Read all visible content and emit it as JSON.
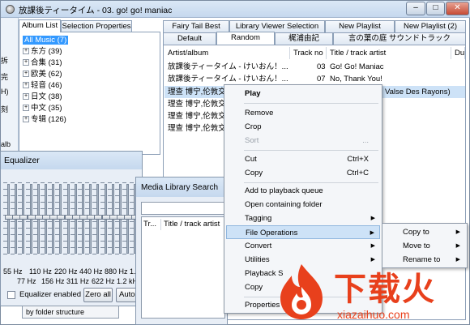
{
  "window": {
    "title": "放課後ティータイム - 03. go! go! maniac",
    "minimize": "–",
    "maximize": "□",
    "close": "✕"
  },
  "left_strip": [
    "拆",
    "完",
    "H)",
    "刻",
    "alb"
  ],
  "album_list": {
    "tabs": [
      "Album List",
      "Selection Properties"
    ],
    "items": [
      {
        "label": "All Music (7)",
        "expander": ""
      },
      {
        "label": "东方 (39)",
        "expander": "+"
      },
      {
        "label": "合集 (31)",
        "expander": "+"
      },
      {
        "label": "欧美 (62)",
        "expander": "+"
      },
      {
        "label": "轻音 (46)",
        "expander": "+"
      },
      {
        "label": "日文 (38)",
        "expander": "+"
      },
      {
        "label": "中文 (35)",
        "expander": "+"
      },
      {
        "label": "专辑 (126)",
        "expander": "+"
      }
    ]
  },
  "playlist_tabs": {
    "row1": [
      "Fairy Tail Best",
      "Library Viewer Selection",
      "New Playlist",
      "New Playlist (2)"
    ],
    "row2": [
      "Default",
      "Random",
      "梶浦由記",
      "言の葉の庭 サウンドトラック"
    ]
  },
  "playlist": {
    "columns": [
      "Artist/album",
      "Track no",
      "Title / track artist",
      "Du"
    ],
    "rows": [
      {
        "artist": "放課後ティータイム - けいおん！...",
        "track": "03",
        "title": "Go! Go! Maniac"
      },
      {
        "artist": "放課後ティータイム - けいおん！...",
        "track": "07",
        "title": "No, Thank You!"
      },
      {
        "artist": "理查 博宁,伦敦交",
        "track": "",
        "title": "Valse Des Rayons)"
      },
      {
        "artist": "理查 博宁,伦敦交",
        "track": "",
        "title": ""
      },
      {
        "artist": "理查 博宁,伦敦交",
        "track": "",
        "title": ""
      },
      {
        "artist": "理查 博宁,伦敦交",
        "track": "",
        "title": ""
      }
    ]
  },
  "equalizer": {
    "title": "Equalizer",
    "bands_row1": [
      "55 Hz",
      "110 Hz",
      "220 Hz",
      "440 Hz",
      "880 Hz",
      "1.8"
    ],
    "bands_row2": [
      "77 Hz",
      "156 Hz",
      "311 Hz",
      "622 Hz",
      "1.2 kH"
    ],
    "enabled_label": "Equalizer enabled",
    "zero_all": "Zero all",
    "auto": "Auto",
    "dropdown": "by folder structure"
  },
  "media_search": {
    "title": "Media Library Search",
    "columns": [
      "Tr...",
      "Title / track artist"
    ]
  },
  "context_menu": {
    "items": [
      {
        "label": "Play",
        "shortcut": "",
        "bold": true
      },
      {
        "label": "Remove",
        "shortcut": ""
      },
      {
        "label": "Crop",
        "shortcut": ""
      },
      {
        "label": "Sort",
        "shortcut": "...",
        "disabled": true
      },
      {
        "label": "Cut",
        "shortcut": "Ctrl+X"
      },
      {
        "label": "Copy",
        "shortcut": "Ctrl+C"
      },
      {
        "label": "Add to playback queue",
        "shortcut": ""
      },
      {
        "label": "Open containing folder",
        "shortcut": ""
      },
      {
        "label": "Tagging",
        "shortcut": ""
      },
      {
        "label": "File Operations",
        "shortcut": ""
      },
      {
        "label": "Convert",
        "shortcut": ""
      },
      {
        "label": "Utilities",
        "shortcut": ""
      },
      {
        "label": "Playback S",
        "shortcut": ""
      },
      {
        "label": "Copy",
        "shortcut": ""
      },
      {
        "label": "Properties",
        "shortcut": ""
      }
    ]
  },
  "submenu": {
    "items": [
      "Copy to",
      "Move to",
      "Rename to"
    ]
  },
  "watermark": {
    "brand": "下载火",
    "url": "xiazaihuo.com"
  },
  "colors": {
    "accent": "#3399ff",
    "selection": "#cde2f7",
    "watermark": "#e8401c"
  }
}
